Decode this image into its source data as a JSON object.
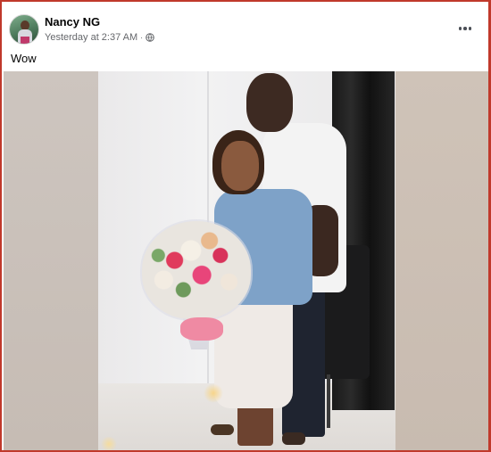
{
  "post": {
    "author_name": "Nancy NG",
    "timestamp": "Yesterday at 2:37 AM",
    "separator": "·",
    "audience_icon": "globe-icon",
    "more_icon": "more-options-icon",
    "caption": "Wow"
  },
  "colors": {
    "frame_border": "#c0392b",
    "text_primary": "#050505",
    "text_secondary": "#65676b"
  }
}
